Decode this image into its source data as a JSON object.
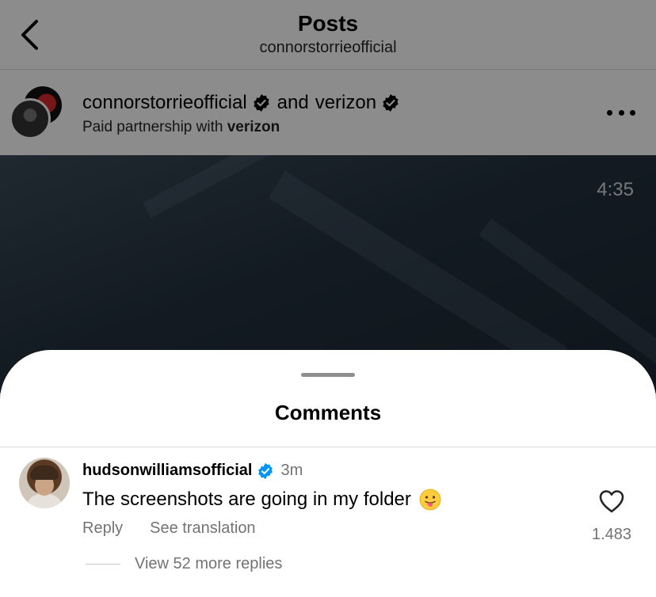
{
  "header": {
    "title": "Posts",
    "subtitle": "connorstorrieofficial"
  },
  "post": {
    "author": "connorstorrieofficial",
    "joiner": "and",
    "collaborator": "verizon",
    "partnership_prefix": "Paid partnership with",
    "partnership_brand": "verizon",
    "video_time": "4:35"
  },
  "comments_sheet": {
    "title": "Comments",
    "comment": {
      "username": "hudsonwilliamsofficial",
      "time": "3m",
      "text": "The screenshots are going in my folder",
      "emoji_icon": "face-with-tongue-icon",
      "reply_label": "Reply",
      "translate_label": "See translation",
      "like_count": "1.483",
      "view_replies_label": "View 52 more replies"
    }
  },
  "colors": {
    "verified_blue": "#0095f6",
    "muted_text": "#737373",
    "overlay": "rgba(0,0,0,0.45)"
  }
}
